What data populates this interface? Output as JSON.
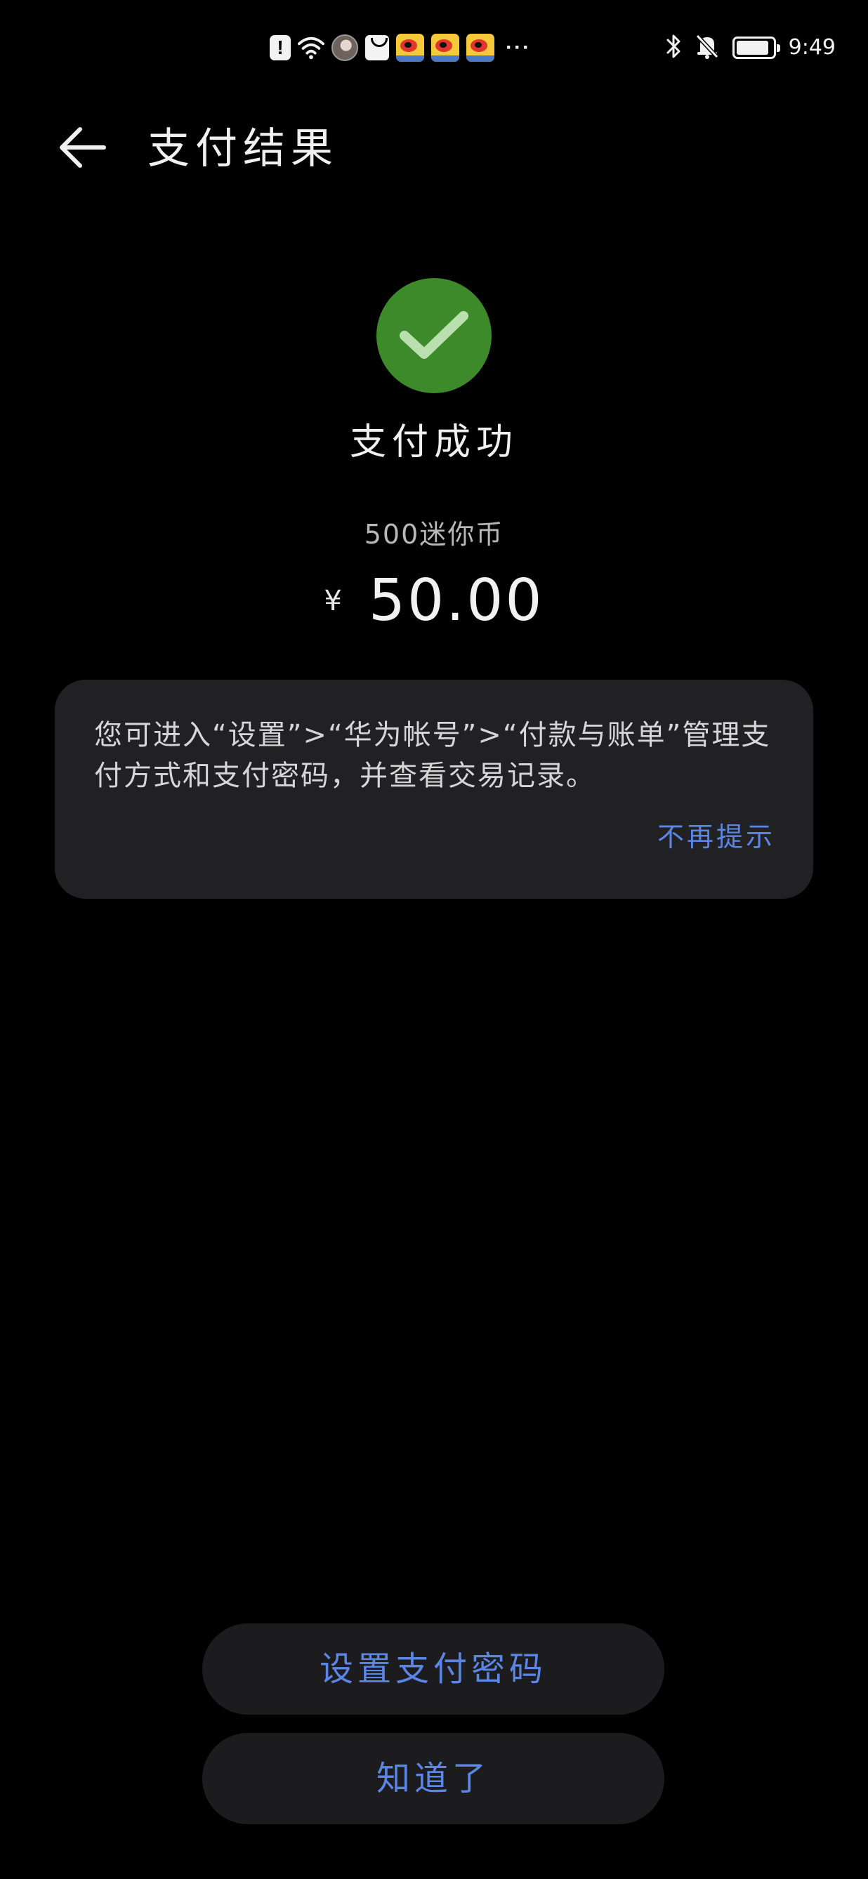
{
  "status_bar": {
    "time": "9:49",
    "notification_icons": [
      "alert-icon",
      "wifi-icon",
      "avatar-icon",
      "shopping-bag-icon",
      "weibo-icon",
      "weibo-icon",
      "weibo-icon"
    ],
    "more": "···",
    "battery_level": 0.9
  },
  "header": {
    "title": "支付结果"
  },
  "result": {
    "status": "支付成功",
    "product": "500迷你币",
    "currency_symbol": "¥",
    "amount": "50.00",
    "success_color": "#3d8a2a"
  },
  "tip": {
    "text": "您可进入“设置”>“华为帐号”>“付款与账单”管理支付方式和支付密码，并查看交易记录。",
    "dismiss_label": "不再提示"
  },
  "actions": {
    "set_password_label": "设置支付密码",
    "ok_label": "知道了"
  },
  "colors": {
    "background": "#000000",
    "card": "#212124",
    "button": "#1c1c1e",
    "accent_blue": "#5b86e5"
  }
}
